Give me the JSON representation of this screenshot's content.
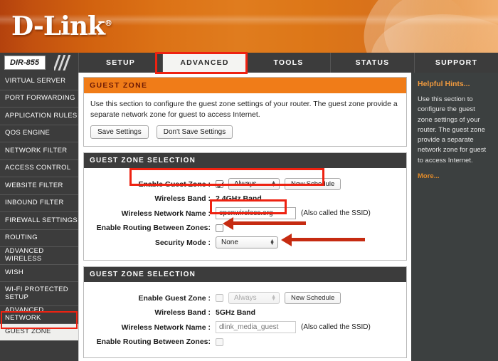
{
  "brand": {
    "name": "D-Link",
    "reg": "®"
  },
  "nav": {
    "model": "DIR-855",
    "tabs": [
      {
        "label": "SETUP",
        "active": false
      },
      {
        "label": "ADVANCED",
        "active": true
      },
      {
        "label": "TOOLS",
        "active": false
      },
      {
        "label": "STATUS",
        "active": false
      },
      {
        "label": "SUPPORT",
        "active": false
      }
    ]
  },
  "sidebar": {
    "items": [
      {
        "label": "VIRTUAL SERVER",
        "selected": false
      },
      {
        "label": "PORT FORWARDING",
        "selected": false
      },
      {
        "label": "APPLICATION RULES",
        "selected": false
      },
      {
        "label": "QOS ENGINE",
        "selected": false
      },
      {
        "label": "NETWORK FILTER",
        "selected": false
      },
      {
        "label": "ACCESS CONTROL",
        "selected": false
      },
      {
        "label": "WEBSITE FILTER",
        "selected": false
      },
      {
        "label": "INBOUND FILTER",
        "selected": false
      },
      {
        "label": "FIREWALL SETTINGS",
        "selected": false
      },
      {
        "label": "ROUTING",
        "selected": false
      },
      {
        "label": "ADVANCED WIRELESS",
        "selected": false
      },
      {
        "label": "WISH",
        "selected": false
      },
      {
        "label": "WI-FI PROTECTED SETUP",
        "selected": false
      },
      {
        "label": "ADVANCED NETWORK",
        "selected": false
      },
      {
        "label": "GUEST ZONE",
        "selected": true
      }
    ]
  },
  "page": {
    "title": "GUEST ZONE",
    "description": "Use this section to configure the guest zone settings of your router. The guest zone provide a separate network zone for guest to access Internet.",
    "save_label": "Save Settings",
    "dont_save_label": "Don't Save Settings"
  },
  "zone_24": {
    "panel_title": "GUEST ZONE SELECTION",
    "enable_label": "Enable Guest Zone :",
    "enable_checked": true,
    "schedule_value": "Always",
    "new_schedule_label": "New Schedule",
    "band_label": "Wireless Band :",
    "band_value": "2.4GHz Band",
    "ssid_label": "Wireless Network Name :",
    "ssid_value": "openwireless.org",
    "ssid_note": "(Also called the SSID)",
    "routing_label": "Enable Routing Between Zones:",
    "routing_checked": false,
    "security_label": "Security Mode :",
    "security_value": "None"
  },
  "zone_5": {
    "panel_title": "GUEST ZONE SELECTION",
    "enable_label": "Enable Guest Zone :",
    "enable_checked": false,
    "schedule_value": "Always",
    "new_schedule_label": "New Schedule",
    "band_label": "Wireless Band :",
    "band_value": "5GHz Band",
    "ssid_label": "Wireless Network Name :",
    "ssid_value": "dlink_media_guest",
    "ssid_note": "(Also called the SSID)",
    "routing_label": "Enable Routing Between Zones:",
    "routing_checked": false
  },
  "hints": {
    "title": "Helpful Hints...",
    "text": "Use this section to configure the guest zone settings of your router. The guest zone provide a separate network zone for guest to access Internet.",
    "more": "More..."
  },
  "colors": {
    "brand_orange": "#f07c18",
    "header_dark": "#3c3c3c",
    "annotation_red": "#ee2211",
    "arrow_red": "#c62b11",
    "hints_bg": "#3c4040"
  }
}
